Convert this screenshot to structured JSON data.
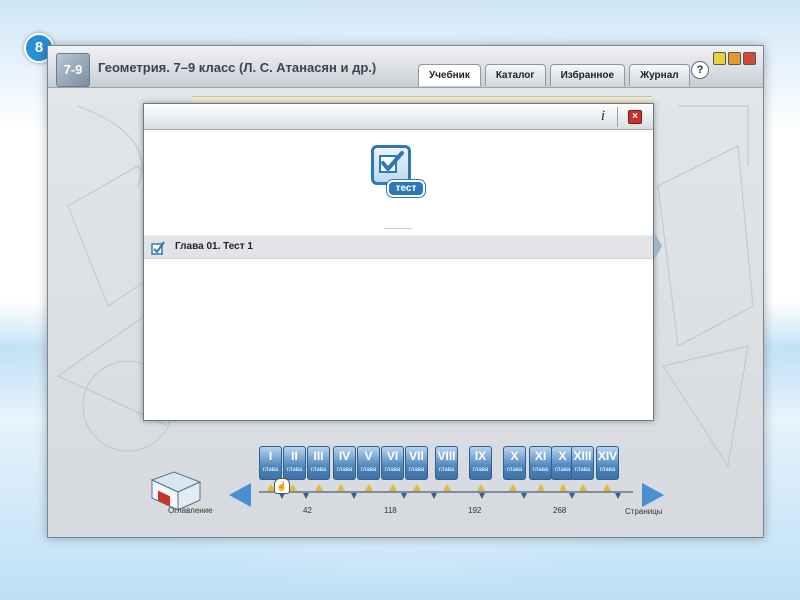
{
  "slide": {
    "number": "8"
  },
  "app": {
    "title": "Геометрия. 7–9 класс (Л. С. Атанасян и др.)",
    "logo_text": "7-9",
    "tabs": [
      {
        "label": "Учебник",
        "active": true
      },
      {
        "label": "Каталог",
        "active": false
      },
      {
        "label": "Избранное",
        "active": false
      },
      {
        "label": "Журнал",
        "active": false
      }
    ],
    "help_label": "?"
  },
  "dialog": {
    "info_label": "i",
    "close_label": "×",
    "test_icon_label": "тест",
    "items": [
      {
        "label": "Глава 01. Тест 1"
      }
    ]
  },
  "navigation": {
    "toc_label": "Оглавление",
    "pages_label": "Страницы",
    "chapters": [
      {
        "num": "I",
        "sub": "глава"
      },
      {
        "num": "II",
        "sub": "глава"
      },
      {
        "num": "III",
        "sub": "глава"
      },
      {
        "num": "IV",
        "sub": "глава"
      },
      {
        "num": "V",
        "sub": "глава"
      },
      {
        "num": "VI",
        "sub": "глава"
      },
      {
        "num": "VII",
        "sub": "глава"
      },
      {
        "num": "VIII",
        "sub": "глава"
      },
      {
        "num": "IX",
        "sub": "глава"
      },
      {
        "num": "X",
        "sub": "глава"
      },
      {
        "num": "XI",
        "sub": "глава"
      },
      {
        "num": "X",
        "sub": "глава"
      },
      {
        "num": "XIII",
        "sub": "глава"
      },
      {
        "num": "XIV",
        "sub": "глава"
      }
    ],
    "page_marks": [
      "42",
      "118",
      "192",
      "268"
    ]
  },
  "colors": {
    "accent": "#4a8fd0",
    "close_red": "#c8332c",
    "slide_number_bg": "#2a8fd6"
  }
}
